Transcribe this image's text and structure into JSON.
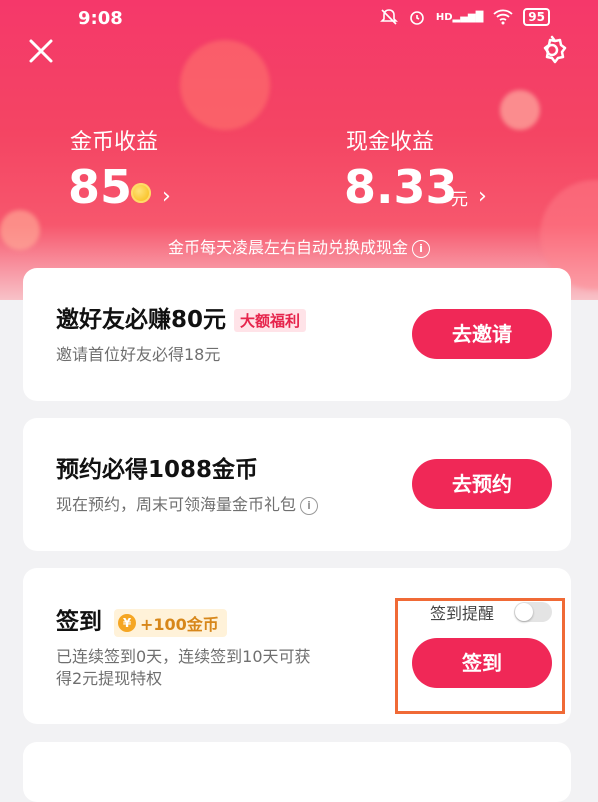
{
  "status_bar": {
    "time": "9:08",
    "network": "HD",
    "battery": "95"
  },
  "header": {
    "coin_label": "金币收益",
    "coin_value": "85",
    "cash_label": "现金收益",
    "cash_value": "8.33",
    "cash_unit": "元",
    "note": "金币每天凌晨左右自动兑换成现金"
  },
  "cards": {
    "invite": {
      "title": "邀好友必赚80元",
      "tag": "大额福利",
      "subtitle": "邀请首位好友必得18元",
      "button": "去邀请"
    },
    "reserve": {
      "title": "预约必得1088金币",
      "subtitle": "现在预约，周末可领海量金币礼包",
      "button": "去预约"
    },
    "checkin": {
      "title": "签到",
      "reward": "+100金币",
      "subtitle_line1": "已连续签到0天，连续签到10天可获",
      "subtitle_line2": "得2元提现特权",
      "reminder_label": "签到提醒",
      "reminder_on": false,
      "button": "签到"
    }
  },
  "colors": {
    "primary": "#f02857",
    "highlight": "#f06a36"
  }
}
